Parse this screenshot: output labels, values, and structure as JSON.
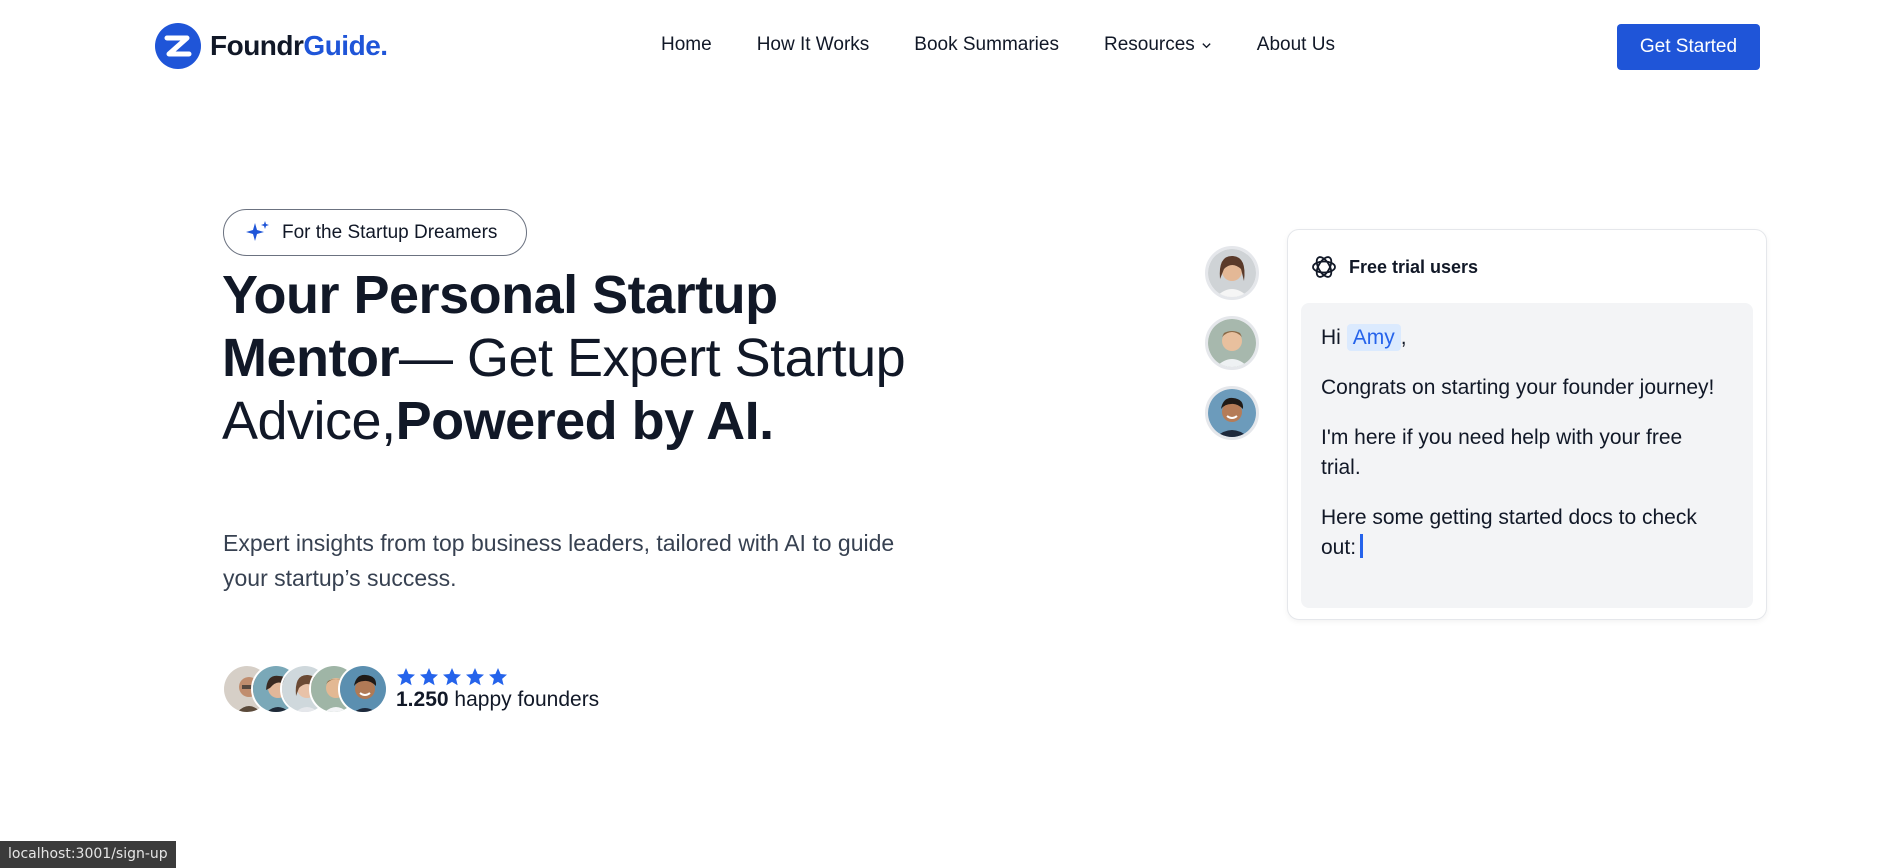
{
  "brand": {
    "name_part1": "Foundr",
    "name_part2": "Guide",
    "name_dot": "."
  },
  "nav": {
    "items": [
      {
        "label": "Home"
      },
      {
        "label": "How It Works"
      },
      {
        "label": "Book Summaries"
      },
      {
        "label": "Resources"
      },
      {
        "label": "About Us"
      }
    ],
    "cta_label": "Get Started"
  },
  "hero": {
    "badge": "For the Startup Dreamers",
    "headline_bold_1": "Your Personal Startup Mentor",
    "headline_light": "— Get Expert Startup Advice,",
    "headline_bold_2": "Powered by AI.",
    "subtext": "Expert insights from top business leaders, tailored with AI to guide your startup’s success.",
    "rating_stars": 5,
    "founders_count": "1.250",
    "founders_label": "happy founders"
  },
  "chat": {
    "header": "Free trial users",
    "greeting": "Hi",
    "name": "Amy",
    "comma": ",",
    "line1": "Congrats on starting your founder journey!",
    "line2": "I'm here if you need help with your free trial.",
    "line3": "Here some getting started docs to check out:"
  },
  "status_url": "localhost:3001/sign-up",
  "colors": {
    "accent": "#1f55d8",
    "star": "#2563eb",
    "chip_bg": "#dbeafe"
  }
}
